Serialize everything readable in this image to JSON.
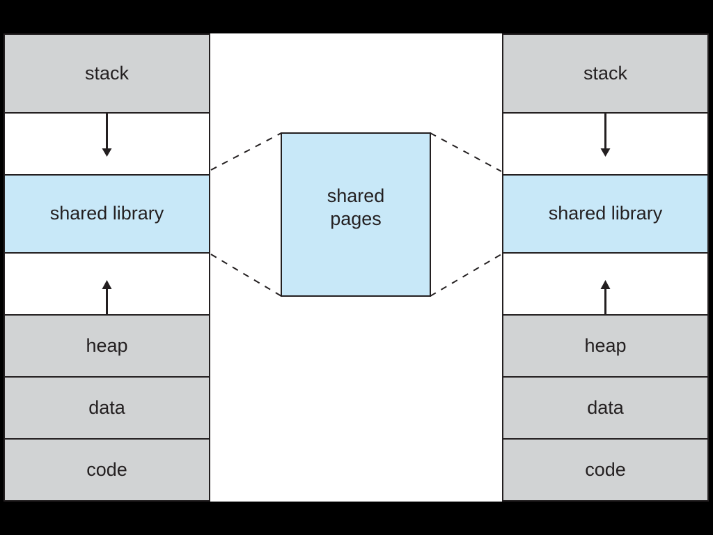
{
  "colors": {
    "segment": "#d1d3d4",
    "shared": "#c8e8f8",
    "border": "#231f20",
    "background": "#000000",
    "canvas": "#ffffff"
  },
  "left_process": {
    "segments": [
      {
        "label": "stack",
        "kind": "segment"
      },
      {
        "label": "",
        "kind": "free",
        "arrow": "down"
      },
      {
        "label": "shared library",
        "kind": "shared"
      },
      {
        "label": "",
        "kind": "free",
        "arrow": "up"
      },
      {
        "label": "heap",
        "kind": "segment"
      },
      {
        "label": "data",
        "kind": "segment"
      },
      {
        "label": "code",
        "kind": "segment"
      }
    ]
  },
  "right_process": {
    "segments": [
      {
        "label": "stack",
        "kind": "segment"
      },
      {
        "label": "",
        "kind": "free",
        "arrow": "down"
      },
      {
        "label": "shared library",
        "kind": "shared"
      },
      {
        "label": "",
        "kind": "free",
        "arrow": "up"
      },
      {
        "label": "heap",
        "kind": "segment"
      },
      {
        "label": "data",
        "kind": "segment"
      },
      {
        "label": "code",
        "kind": "segment"
      }
    ]
  },
  "physical": {
    "shared_pages_label_line1": "shared",
    "shared_pages_label_line2": "pages"
  }
}
